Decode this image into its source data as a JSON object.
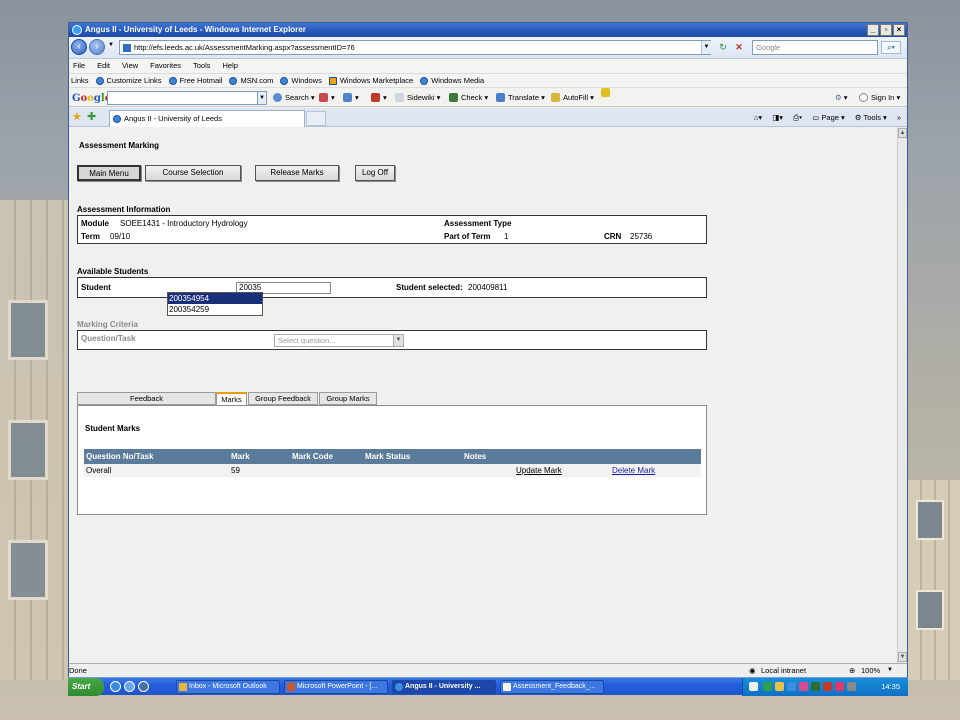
{
  "window": {
    "title": "Angus II - University of Leeds - Windows Internet Explorer",
    "url": "http://efs.leeds.ac.uk/AssessmentMarking.aspx?assessmentID=76",
    "search_placeholder": "Google"
  },
  "menu": [
    "File",
    "Edit",
    "View",
    "Favorites",
    "Tools",
    "Help"
  ],
  "links_bar": {
    "label": "Links",
    "items": [
      "Customize Links",
      "Free Hotmail",
      "MSN.com",
      "Windows",
      "Windows Marketplace",
      "Windows Media"
    ]
  },
  "google_toolbar": {
    "logo": "Google",
    "search": "Search",
    "sidewiki": "Sidewiki",
    "check": "Check",
    "translate": "Translate",
    "autofill": "AutoFill",
    "signin": "Sign In"
  },
  "tab": {
    "title": "Angus II - University of Leeds"
  },
  "command_bar": {
    "page": "Page",
    "tools": "Tools"
  },
  "page": {
    "title": "Assessment Marking",
    "buttons": {
      "main_menu": "Main Menu",
      "course_selection": "Course Selection",
      "release_marks": "Release Marks",
      "log_off": "Log Off"
    },
    "assessment_info": {
      "heading": "Assessment Information",
      "module_label": "Module",
      "module_value": "SOEE1431 - Introductory Hydrology",
      "assessment_type_label": "Assessment Type",
      "term_label": "Term",
      "term_value": "09/10",
      "part_of_term_label": "Part of Term",
      "part_of_term_value": "1",
      "crn_label": "CRN",
      "crn_value": "25736"
    },
    "students": {
      "heading": "Available Students",
      "student_label": "Student",
      "student_input": "20035",
      "suggestions": [
        "200354954",
        "200354259"
      ],
      "selected_label": "Student selected:",
      "selected_value": "200409811"
    },
    "criteria": {
      "heading": "Marking Criteria",
      "question_label": "Question/Task",
      "select_placeholder": "Select question..."
    },
    "tabs": [
      "Feedback",
      "Marks",
      "Group Feedback",
      "Group Marks"
    ],
    "active_tab": "Marks",
    "marks": {
      "heading": "Student Marks",
      "columns": [
        "Question No/Task",
        "Mark",
        "Mark Code",
        "Mark Status",
        "Notes"
      ],
      "rows": [
        {
          "task": "Overall",
          "mark": "59",
          "update": "Update Mark",
          "delete": "Delete Mark"
        }
      ]
    }
  },
  "status": {
    "text": "Done",
    "zone": "Local intranet",
    "zoom": "100%"
  },
  "taskbar": {
    "start": "Start",
    "items": [
      "Inbox - Microsoft Outlook",
      "Microsoft PowerPoint - [...",
      "Angus II - University ...",
      "Assessment_Feedback_..."
    ],
    "clock": "14:35"
  }
}
